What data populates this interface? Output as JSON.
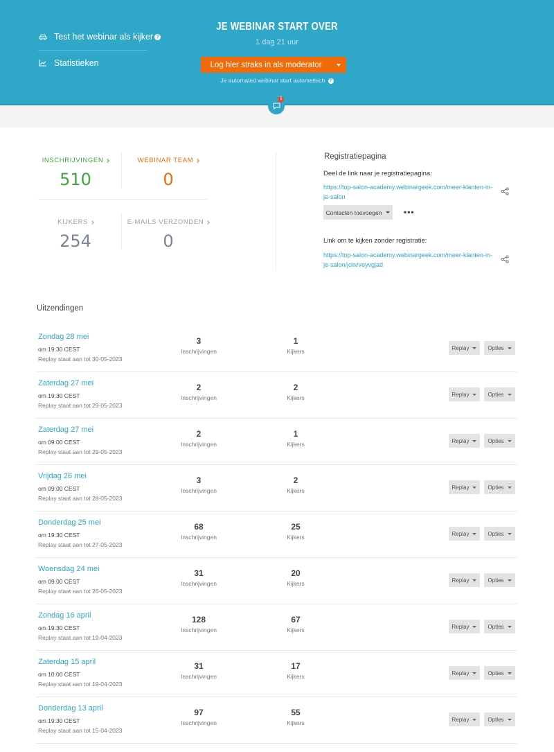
{
  "header": {
    "test_link": "Test het webinar als kijker",
    "stats_link": "Statistieken",
    "title": "JE WEBINAR START OVER",
    "countdown": "1 dag 21 uur",
    "moderator_button": "Log hier straks in als moderator",
    "auto_note": "Je automated webinar start automatisch",
    "chat_badge": "5",
    "help_mark": "?",
    "colors": {
      "primary": "#2ea7c9",
      "accent": "#f26b0a",
      "success": "#3fa63c"
    }
  },
  "stats": {
    "inschrijvingen": {
      "label": "INSCHRIJVINGEN",
      "value": "510"
    },
    "team": {
      "label": "WEBINAR TEAM",
      "value": "0"
    },
    "kijkers": {
      "label": "KIJKERS",
      "value": "254"
    },
    "emails": {
      "label": "E-MAILS VERZONDEN",
      "value": "0"
    }
  },
  "registratie": {
    "title": "Registratiepagina",
    "share_label": "Deel de link naar je registratiepagina:",
    "share_link": "https://top-salon-academy.webinargeek.com/meer-klanten-in-je-salon",
    "contacts_button": "Contacten toevoegen",
    "more": "•••",
    "direct_label": "Link om te kijken zonder registratie:",
    "direct_link": "https://top-salon-academy.webinargeek.com/meer-klanten-in-je-salon/join/veyvgjad"
  },
  "broadcasts": {
    "title": "Uitzendingen",
    "reg_label": "Inschrijvingen",
    "view_label": "Kijkers",
    "replay_btn": "Replay",
    "options_btn": "Opties",
    "items": [
      {
        "date": "Zondag 28 mei",
        "time": "om 19:30 CEST",
        "replay": "Replay staat aan tot 30-05-2023",
        "regs": "3",
        "views": "1"
      },
      {
        "date": "Zaterdag 27 mei",
        "time": "om 19:30 CEST",
        "replay": "Replay staat aan tot 29-05-2023",
        "regs": "2",
        "views": "2"
      },
      {
        "date": "Zaterdag 27 mei",
        "time": "om 09:00 CEST",
        "replay": "Replay staat aan tot 29-05-2023",
        "regs": "2",
        "views": "1"
      },
      {
        "date": "Vrijdag 26 mei",
        "time": "om 09:00 CEST",
        "replay": "Replay staat aan tot 28-05-2023",
        "regs": "3",
        "views": "2"
      },
      {
        "date": "Donderdag 25 mei",
        "time": "om 19:30 CEST",
        "replay": "Replay staat aan tot 27-05-2023",
        "regs": "68",
        "views": "25"
      },
      {
        "date": "Woensdag 24 mei",
        "time": "om 09:00 CEST",
        "replay": "Replay staat aan tot 26-05-2023",
        "regs": "31",
        "views": "20"
      },
      {
        "date": "Zondag 16 april",
        "time": "om 19:30 CEST",
        "replay": "Replay staat aan tot 19-04-2023",
        "regs": "128",
        "views": "67"
      },
      {
        "date": "Zaterdag 15 april",
        "time": "om 10:00 CEST",
        "replay": "Replay staat aan tot 19-04-2023",
        "regs": "31",
        "views": "17"
      },
      {
        "date": "Donderdag 13 april",
        "time": "om 19:30 CEST",
        "replay": "Replay staat aan tot 15-04-2023",
        "regs": "97",
        "views": "55"
      }
    ]
  }
}
